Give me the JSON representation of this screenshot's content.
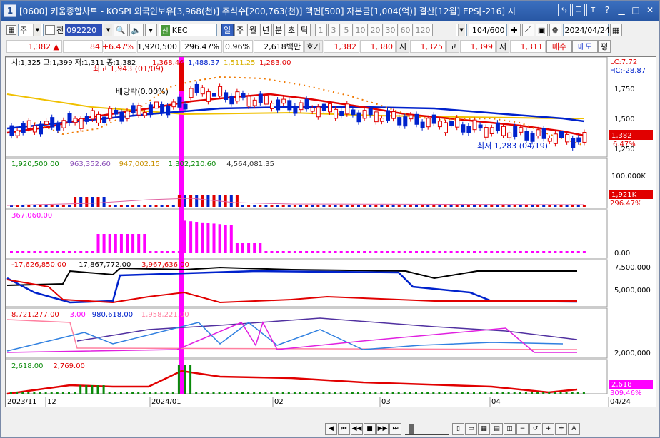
{
  "window": {
    "number": "1",
    "title": "[0600] 키움종합차트 - KOSPI 외국인보유[3,968(천)] 주식수[200,763(천)] 액면[500] 자본금[1,004(억)] 결산[12월] EPS[-216] 시"
  },
  "toolbar": {
    "period_mode": "주",
    "prev_label": "전",
    "stock_code": "092220",
    "stock_name": "KEC",
    "credit_badge": "신",
    "periods": [
      "일",
      "주",
      "월",
      "년",
      "분",
      "초",
      "틱"
    ],
    "active_period": "일",
    "intervals": [
      "1",
      "3",
      "5",
      "10",
      "20",
      "30",
      "60",
      "120"
    ],
    "count_display": "104",
    "count_total": "/600",
    "date": "2024/04/24"
  },
  "quote": {
    "price": "1,382",
    "change": "84",
    "change_pct": "+6.47%",
    "volume": "1,920,500",
    "volume_ratio": "296.47%",
    "turnover": "0.96%",
    "amount": "2,618백만",
    "hoga_label": "호가",
    "ask": "1,382",
    "bid": "1,380",
    "open_label": "시",
    "open": "1,325",
    "high_label": "고",
    "high": "1,399",
    "low_label": "저",
    "low": "1,311",
    "buy_label": "매수",
    "sell_label": "매도",
    "avg_label": "평"
  },
  "price_panel": {
    "header": "시:1,325 고:1,399 저:1,311 종:1,382",
    "ma_values": [
      "1,368.46",
      "1,488.37",
      "1,511.25",
      "1,283.00"
    ],
    "high_annot": "최고 1,943 (01/09)",
    "low_annot": "최저 1,283 (04/19)",
    "dividend_annot": "배당락(0.00%)",
    "lc": "LC:7.72",
    "hc": "HC:-28.87",
    "axis": [
      "1,750",
      "1,500",
      "1,250"
    ],
    "current_tag": "1,382",
    "pct_tag": "6.47%"
  },
  "volume_panel": {
    "header": [
      "1,920,500.00",
      "963,352.60",
      "947,002.15",
      "1,302,210.60",
      "4,564,081.35"
    ],
    "axis": "100,000K",
    "current_tag": "1,921K",
    "pct_tag": "296.47%"
  },
  "panel3": {
    "header": "367,060.00",
    "axis": "0.00"
  },
  "panel4": {
    "header": [
      "-17,626,850.00",
      "17,867,772.00",
      "3,967,636.00"
    ],
    "axis": [
      "7,500,000",
      "5,000,000"
    ]
  },
  "panel5": {
    "header": [
      "8,721,277.00",
      "3.00",
      "980,618.00",
      "1,958,221.00"
    ],
    "axis": "2,000,000"
  },
  "panel6": {
    "header": [
      "2,618.00",
      "2,769.00"
    ],
    "current_tag": "2,618",
    "pct_tag": "309.46%"
  },
  "xaxis": [
    "2023/11",
    "12",
    "2024/01",
    "02",
    "03",
    "04",
    "04/24"
  ],
  "colors": {
    "up": "#e10000",
    "down": "#0022cc",
    "highlight": "#ff00ff",
    "ma20": "#f0c000"
  }
}
